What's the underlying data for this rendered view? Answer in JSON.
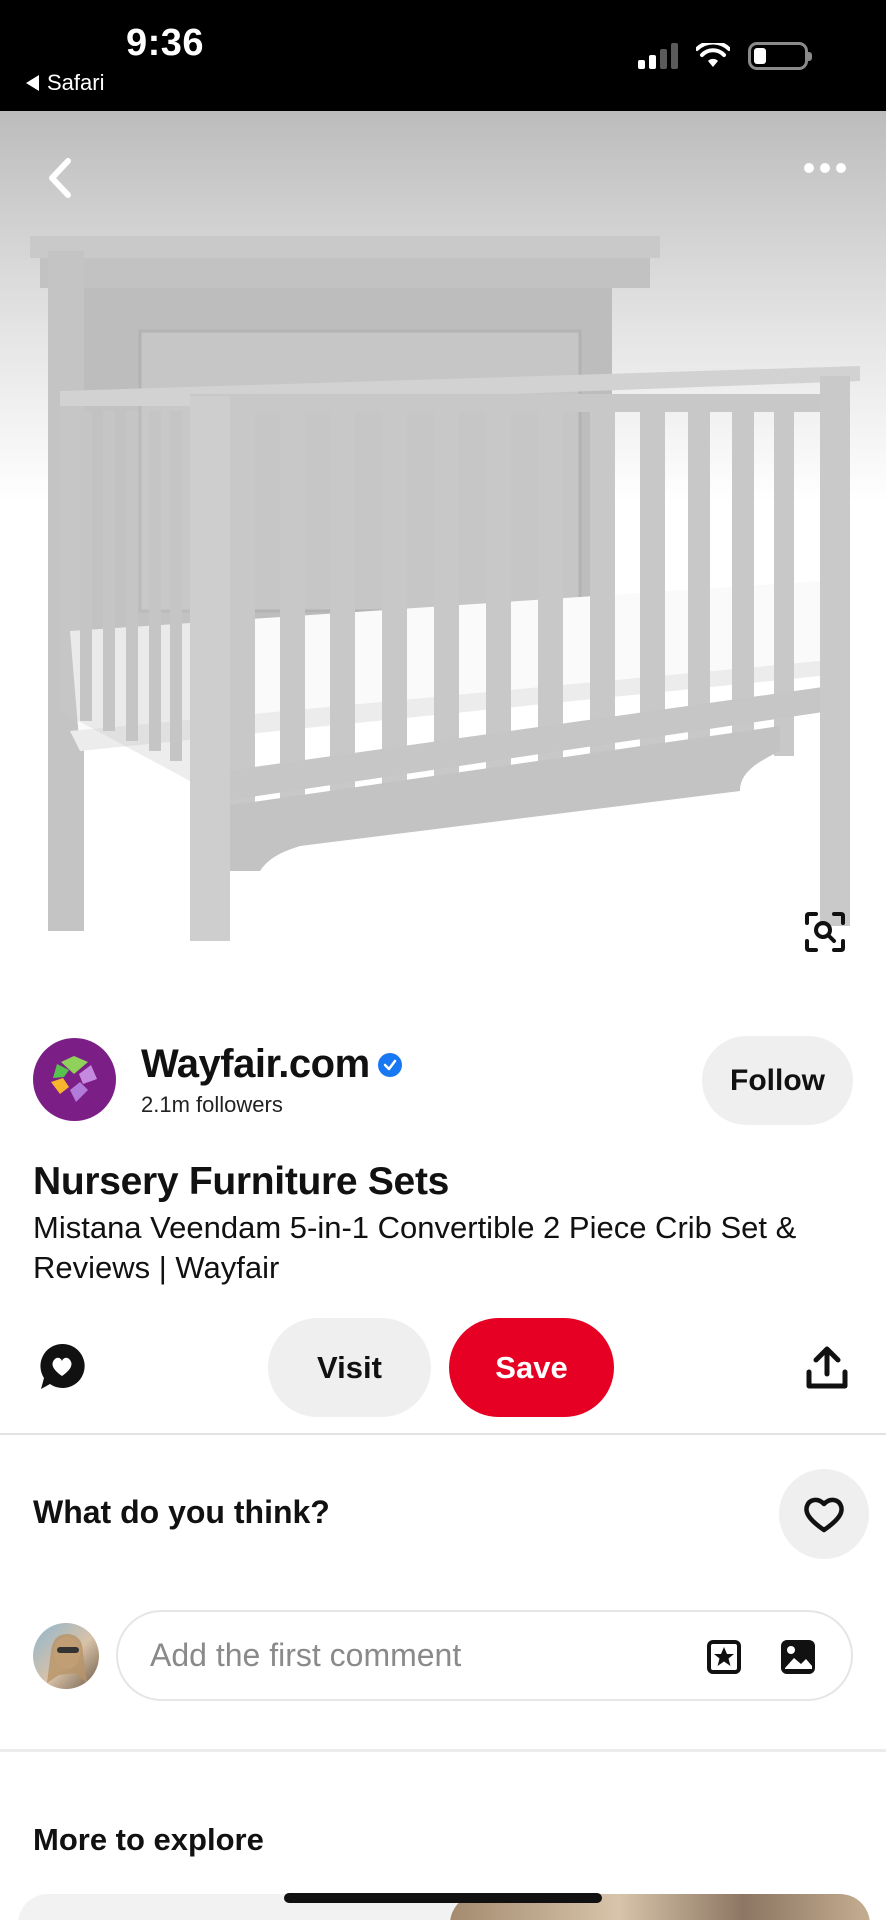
{
  "status_bar": {
    "time": "9:36",
    "back_app": "Safari"
  },
  "hero": {
    "back_icon": "chevron-left-icon",
    "more_icon": "more-horizontal-icon",
    "lens_icon": "visual-search-icon"
  },
  "creator": {
    "name": "Wayfair.com",
    "verified": true,
    "followers": "2.1m followers",
    "follow_label": "Follow",
    "brand_color": "#7b1f86"
  },
  "pin": {
    "title": "Nursery Furniture Sets",
    "description": "Mistana Veendam 5-in-1 Convertible 2 Piece Crib Set & Reviews | Wayfair"
  },
  "actions": {
    "visit_label": "Visit",
    "save_label": "Save",
    "save_color": "#e60023",
    "comment_icon": "comment-heart-icon",
    "share_icon": "share-icon"
  },
  "feedback": {
    "prompt": "What do you think?",
    "heart_icon": "heart-icon"
  },
  "comment": {
    "placeholder": "Add the first comment",
    "sticker_icon": "sticker-icon",
    "image_icon": "image-icon"
  },
  "explore": {
    "heading": "More to explore"
  }
}
